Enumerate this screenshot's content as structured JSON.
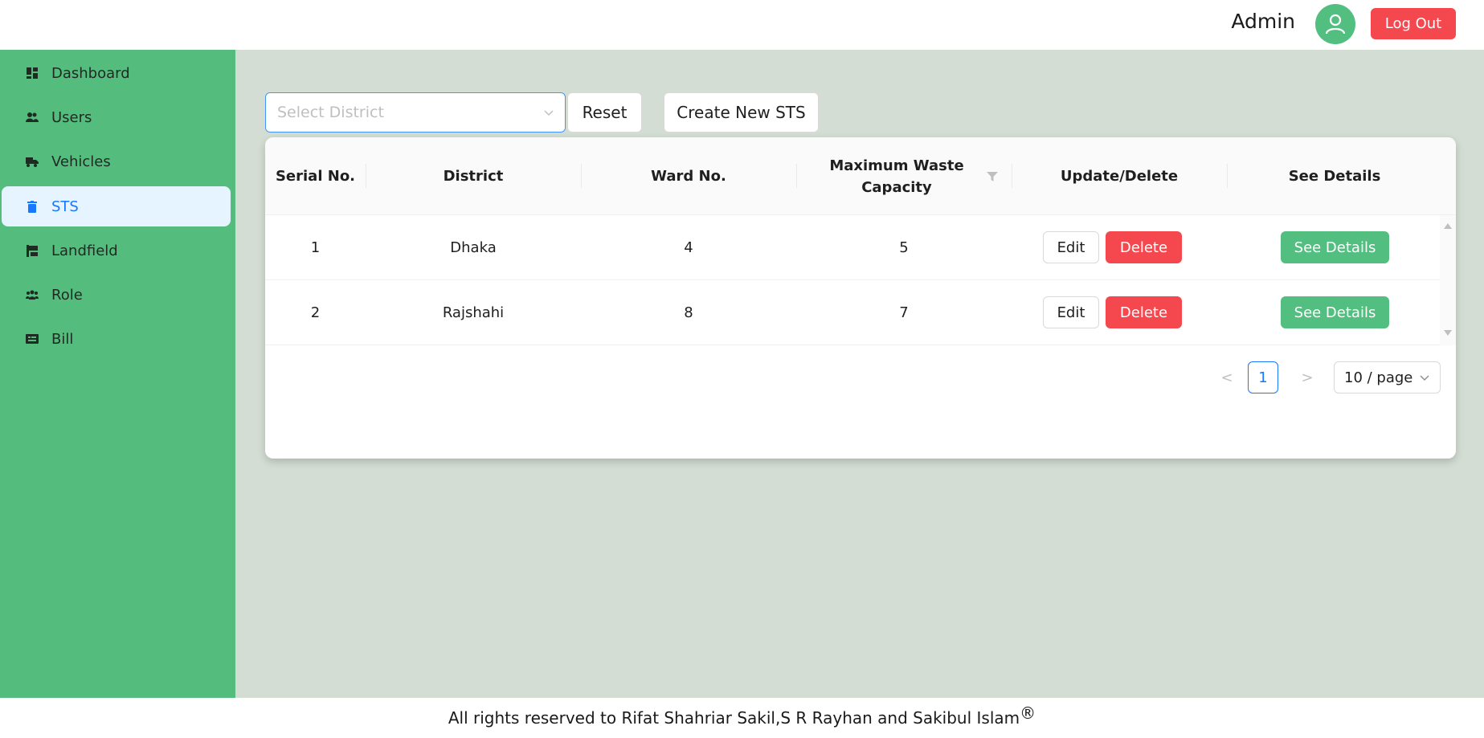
{
  "header": {
    "user_name": "Admin",
    "logout_label": "Log Out",
    "avatar_icon": "user-icon"
  },
  "sidebar": {
    "items": [
      {
        "label": "Dashboard",
        "icon": "dashboard-icon"
      },
      {
        "label": "Users",
        "icon": "users-icon"
      },
      {
        "label": "Vehicles",
        "icon": "truck-icon"
      },
      {
        "label": "STS",
        "icon": "trash-icon",
        "active": true
      },
      {
        "label": "Landfield",
        "icon": "landfill-icon"
      },
      {
        "label": "Role",
        "icon": "team-icon"
      },
      {
        "label": "Bill",
        "icon": "bill-icon"
      }
    ]
  },
  "toolbar": {
    "district_placeholder": "Select District",
    "reset_label": "Reset",
    "create_label": "Create New STS"
  },
  "table": {
    "columns": [
      "Serial No.",
      "District",
      "Ward No.",
      "Maximum Waste Capacity",
      "Update/Delete",
      "See Details"
    ],
    "rows": [
      {
        "serial": "1",
        "district": "Dhaka",
        "ward": "4",
        "capacity": "5"
      },
      {
        "serial": "2",
        "district": "Rajshahi",
        "ward": "8",
        "capacity": "7"
      }
    ],
    "edit_label": "Edit",
    "delete_label": "Delete",
    "details_label": "See Details"
  },
  "pagination": {
    "prev": "<",
    "current_page": "1",
    "next": ">",
    "page_size": "10 / page"
  },
  "footer": {
    "text": "All rights reserved to Rifat Shahriar Sakil,S R Rayhan and Sakibul Islam",
    "mark": "®"
  },
  "colors": {
    "sidebar_bg": "#54bd7e",
    "main_bg": "#d3ddd3",
    "danger": "#f5474e",
    "accent": "#1677ff"
  }
}
